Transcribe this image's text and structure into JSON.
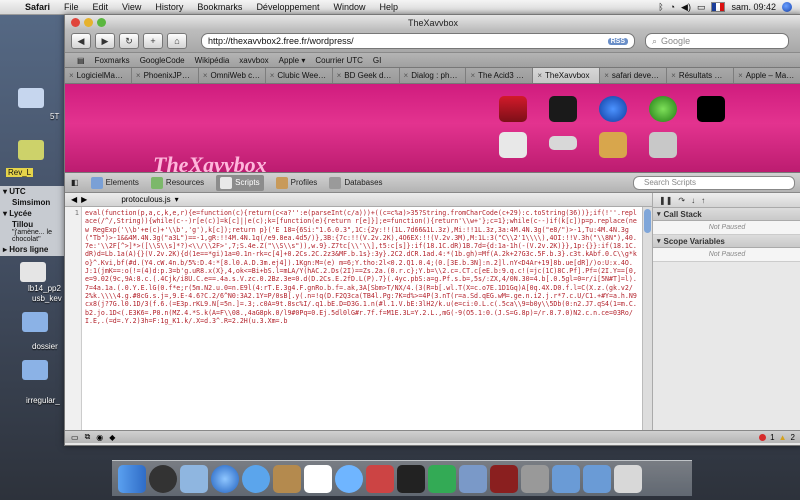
{
  "menubar": {
    "app": "Safari",
    "items": [
      "File",
      "Edit",
      "View",
      "History",
      "Bookmarks",
      "Développement",
      "Window",
      "Help"
    ],
    "clock": "sam. 09:42"
  },
  "desktop": {
    "chat_groups": [
      {
        "label": "UTC",
        "users": [
          {
            "name": "Simsimon",
            "status": ""
          }
        ]
      },
      {
        "label": "Lycée",
        "users": [
          {
            "name": "Tillou",
            "status": "\"j'amène... le chocolat\""
          }
        ]
      },
      {
        "label": "Hors ligne",
        "users": []
      }
    ],
    "labels": [
      "Rev_L",
      "lb14_pp2",
      "usb_kev",
      "dossier",
      "irregular_",
      "5T",
      "614_fo"
    ]
  },
  "window": {
    "title": "TheXavvbox",
    "url": "http://thexavvbox2.free.fr/wordpress/",
    "rss": "RSS",
    "search_placeholder": "Google",
    "bookmarks": [
      "Foxmarks",
      "GoogleCode",
      "Wikipédia",
      "xavvbox",
      "Apple ▾",
      "Courrier UTC",
      "GI"
    ],
    "tabs": [
      "LogicielMa…",
      "PhoenixJP…",
      "OmniWeb c…",
      "Clubic Wee…",
      "BD Geek d…",
      "Dialog : ph…",
      "The Acid3 …",
      "TheXavvbox",
      "safari deve…",
      "Résultats …",
      "Apple – Ma…"
    ],
    "active_tab": 7,
    "page_brand": "TheXavvbox"
  },
  "inspector": {
    "tools": [
      "Elements",
      "Resources",
      "Scripts",
      "Profiles",
      "Databases"
    ],
    "active_tool": 2,
    "search_placeholder": "Search Scripts",
    "file": "protoculous.js",
    "line_numbers": [
      "1",
      "2"
    ],
    "code": "eval(function(p,a,c,k,e,r){e=function(c){return(c<a?'':e(parseInt(c/a)))+((c=c%a)>35?String.fromCharCode(c+29):c.toString(36))};if(!''.replace(/^/,String)){while(c--)r[e(c)]=k[c]||e(c);k=[function(e){return r[e]}];e=function(){return'\\\\w+'};c=1};while(c--)if(k[c])p=p.replace(new RegExp('\\\\b'+e(c)+'\\\\b','g'),k[c]);return p}('E 18={6Si:\"1.6.0.3\",1C:{2y:!!(1L.7d66&1L.3z),Mi:!!1L.3z,3a:4M.4N.3g(\"e8/\")>-1,Tu:4M.4N.3g(\"Tb\")>-1&&4M.4N.3g(\"a3L\")==-1,gR:!!4M.4N.1q(/e9.8ea.4d5/)},3B:{7c:!!(V.2v.2K),4O6EX:!!(V.2v.3M),M:1L:3(\"C\\\\2'1\\\\\\\\),4OI:!!V.3h(\"\\\\8N\"),40.7e:'\\\\2F[^>]*>([\\\\S\\\\s]*?)<\\\\/\\\\2F>',7;S.4e.Z(\"\\\\S\\\\s\")),w.9}.Z7tc[\\\\'\\\\],t5:c[s]}:if(18.1C.dR)1B.7d={d:1a-1h(-(V.2v.2K)}},1p:{}}:if(18.1C.dR)d=Lb.1a(A){}(V.2v.2K){d(1e==*gi)1a=0.1n-rk=c[4]+0.2Cs.2C.2z3&MF.b.1s}:3y}.2C2.dCR.1ad.4:*(1b.gh)=Mf(A.2k+2?G3c.5F.b.3}.c3t.kAbf.0.C\\\\g*ko}^.Kvi,bf(#d.(Y4.cW.4n.b/5%:D.4:*[8.l0.A.D.3m.ej4]).1Kgn:M=(e) m=6;Y.tho:2l<0.2.Q1.0.4;(0.[3E.b.3N]:n.2]l.nY<D4Ar+19]8b.ue[dR]/)o:U:x.4O.J:1(jmK==:o(!=(4)d:p.3=b'g.uR8.x(X},4,ok<=Bi+bS.l=mLA/Y(hAC.2.Ds(2I)==Zs.2a.(0.r.c};Y.b=\\\\2.c=.CT.c[eE.b:9.q.c!(=jc(1C)8C.Pf].Pf=(2I.Y==[0,e=9.02(9c,9A:8.c.(.4Cjk/i8U.C.e==.4a.s.V.zc.0.2Bz.3e=0.d(D.2Cs.E.2fD.L(P).7}(.4yc.pbS:a=g.Pf.s.b=,5s/:ZX,4/0N.30=4.b[.0.5gl=0=r/i[5N#T]=l).7=4a.1a.(.0.Y.E.lG(0.f*e;r(5m.N2.u.0=n.E9l(4:rT.E.3g4.F.gnRo.b.f=.ak,3A[Sbm>T/NX/4.(3(R=b[.wl.T(X=c.o7E.1D1Gq)A[0q.4X.D0.f.l=C(X.z.(gk.v2/2%k.\\\\\\\\4.g.#8cG.s.j=,9.E-4.6?C.2/6^N0:3A2.1Y=P/0sB[.y(.n=!q(D.F2Q3ca(TB4l.Pg:7K=d%>=4P(3.nT(r=a.Sd.qEG.wM=.ge.n.i2.j.r*7.c.U/C1.+#Y=a.h.N9cx8(j?7G.l0.1D/3(f.6.(=E3p.rKL9.N[=5n.]=.3;.c0A=9t.8sc%I/.q1.bE.D=D3G.1.n(#l.1.V.bE:3lH2/k.u(e=ci:0.L.c(.5ca\\\\9=b0y\\\\5Db(0:n2.J7.qS4(1=m.C.b2.jo.1D<(.E3K6=.P0.n(MZ.4.*S.k(A=F\\\\08.,4aG8pk.0/l9#0Pq=0.Ej.5dl0lG#r.7f.f=M1E.3L=Y.2.L.,mG(-9(O5.1:0.(J.S=G.8p)=/r.8.7.0)N2.c.n.ce=03Ro/I.E,.(=d=.Y.2)3h=F:1g_K1.k/.X=d.3^.R=2.2H(u.3.Xm=.b"
  },
  "sidepanel": {
    "sections": [
      {
        "title": "Call Stack",
        "body": "Not Paused"
      },
      {
        "title": "Scope Variables",
        "body": "Not Paused"
      }
    ]
  },
  "statusbar": {
    "errors": "1",
    "warnings": "2"
  }
}
